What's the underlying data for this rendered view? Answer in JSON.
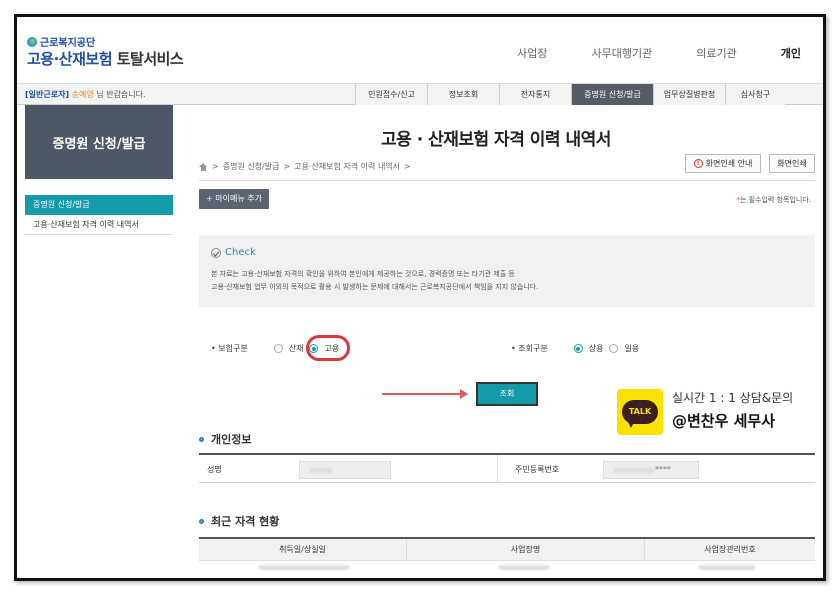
{
  "header": {
    "org_name": "근로복지공단",
    "service_name_part1": "고용·산재보험",
    "service_name_part2": " 토탈서비스",
    "nav": [
      {
        "label": "사업장"
      },
      {
        "label": "사무대행기관"
      },
      {
        "label": "의료기관"
      },
      {
        "label": "개인"
      }
    ]
  },
  "menubar": {
    "user_type": "[일반근로자]",
    "user_name": "송예영",
    "greeting_suffix": " 님 반갑습니다.",
    "items": [
      {
        "label": "민원접수/신고"
      },
      {
        "label": "정보조회"
      },
      {
        "label": "전자통지"
      },
      {
        "label": "증명원 신청/발급"
      },
      {
        "label": "업무상질병판정"
      },
      {
        "label": "심사청구"
      }
    ]
  },
  "sidebar": {
    "title": "증명원 신청/발급",
    "active_item": "증명원 신청/발급",
    "sub_item": "고용·산재보험 자격 이력 내역서"
  },
  "main": {
    "title": "고용 · 산재보험 자격 이력 내역서",
    "breadcrumb_1": "증명원 신청/발급",
    "breadcrumb_2": "고용·산재보험 자격 이력 내역서",
    "breadcrumb_sep": ">",
    "print_guide_label": "화면인쇄 안내",
    "print_label": "화면인쇄",
    "mymenu_label": "+ 마이메뉴 추가",
    "required_star": "*",
    "required_text": "는 필수입력 항목입니다.",
    "check_title": "Check",
    "check_line1": "본 자료는 고용·산재보험 자격의 확인을 위하여 본인에게 제공하는 것으로, 경력증명 또는 타기관 제출 등",
    "check_line2": "고용·산재보험 업무 이외의 목적으로 활용 시 발생하는 문제에 대해서는 근로복지공단에서 책임을 지지 않습니다.",
    "insurance_label": "• 보험구분",
    "insurance_options": [
      "산재",
      "고용"
    ],
    "insurance_selected": "고용",
    "query_type_label": "• 조회구분",
    "query_type_options": [
      "상용",
      "일용"
    ],
    "query_type_selected": "상용",
    "query_button": "조회",
    "personal_section": "개인정보",
    "name_label": "성명",
    "rrn_label": "주민등록번호",
    "rrn_mask": "****",
    "history_section": "최근 자격 현황",
    "history_headers": [
      "취득일/상실일",
      "사업장명",
      "사업장관리번호"
    ]
  },
  "promo": {
    "line1": "실시간 1 : 1 상담&문의",
    "line2": "@변찬우 세무사",
    "kakao_text": "TALK",
    "kakao_color": "#fae100"
  }
}
